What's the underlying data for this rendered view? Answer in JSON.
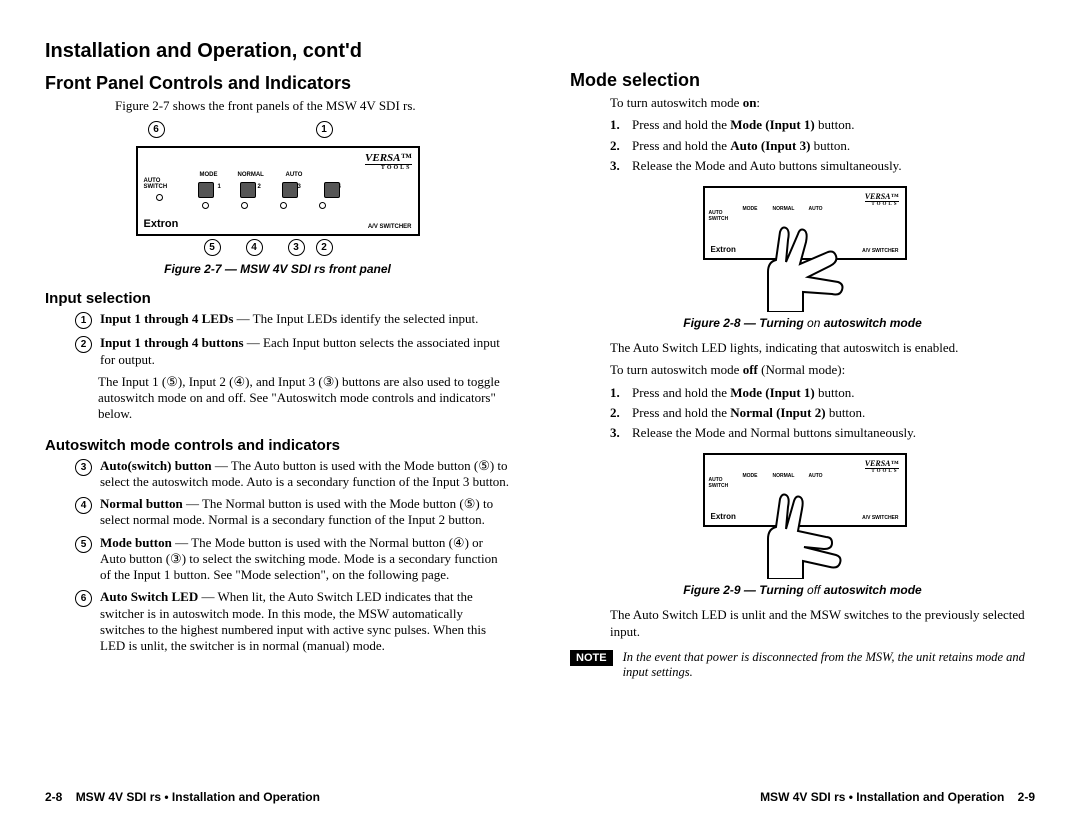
{
  "header": "Installation and Operation, cont'd",
  "left": {
    "h2": "Front Panel Controls and Indicators",
    "intro": "Figure 2-7 shows the front panels of the MSW 4V SDI rs.",
    "fig7_caption": "Figure 2-7 — MSW 4V SDI rs front panel",
    "h3a": "Input selection",
    "item1_lead": "Input 1 through 4 LEDs",
    "item1_body": " — The Input LEDs identify the selected input.",
    "item2_lead": "Input 1 through 4 buttons",
    "item2_body": " — Each Input button selects the associated input for output.",
    "item2_extra": "The Input 1 (⑤), Input 2 (④), and Input 3 (③) buttons are also used to toggle autoswitch mode on and off.  See \"Autoswitch mode controls and indicators\" below.",
    "h3b": "Autoswitch mode controls and indicators",
    "item3_lead": "Auto(switch) button",
    "item3_body": " — The Auto button is used with the Mode button (⑤) to select the autoswitch mode.  Auto is a secondary function of the Input 3 button.",
    "item4_lead": "Normal button",
    "item4_body": " — The Normal button is used with the Mode button (⑤) to select normal mode.  Normal is a secondary function of the Input 2 button.",
    "item5_lead": "Mode button",
    "item5_body": " — The Mode button is used with the Normal button (④) or Auto button (③) to select the switching mode.  Mode is a secondary function of the Input 1 button.  See \"Mode selection\", on the following page.",
    "item6_lead": "Auto Switch LED",
    "item6_body": " — When lit, the Auto Switch LED indicates that the switcher is in autoswitch mode.  In this mode, the MSW automatically switches to the highest numbered input with active sync pulses.  When this LED is unlit, the switcher is in normal (manual) mode."
  },
  "right": {
    "h2": "Mode selection",
    "on_intro_a": "To turn autoswitch mode ",
    "on_intro_b": "on",
    "on_intro_c": ":",
    "on1_a": "Press and hold the ",
    "on1_b": "Mode (Input 1)",
    "on1_c": " button.",
    "on2_a": "Press and hold the ",
    "on2_b": "Auto (Input 3)",
    "on2_c": " button.",
    "on3": "Release the Mode and Auto buttons simultaneously.",
    "fig8_a": "Figure 2-8 — Turning ",
    "fig8_b": "on",
    "fig8_c": " autoswitch mode",
    "after8": "The Auto Switch LED lights, indicating that autoswitch is enabled.",
    "off_intro_a": "To turn autoswitch mode ",
    "off_intro_b": "off",
    "off_intro_c": " (Normal mode):",
    "off1_a": "Press and hold the ",
    "off1_b": "Mode (Input 1)",
    "off1_c": " button.",
    "off2_a": "Press and hold the ",
    "off2_b": "Normal (Input 2)",
    "off2_c": " button.",
    "off3": "Release the Mode and Normal buttons simultaneously.",
    "fig9_a": "Figure 2-9 — Turning ",
    "fig9_b": "off",
    "fig9_c": " autoswitch mode",
    "after9": "The Auto Switch LED is unlit and the MSW switches to the previously selected input.",
    "note_label": "NOTE",
    "note_text": "In the event that power is disconnected from the MSW, the unit retains mode and input settings."
  },
  "panel": {
    "versa": "VERSA",
    "tools": "TOOLS",
    "extron": "Extron",
    "avs": "A/V SWITCHER",
    "auto_switch": "AUTO\nSWITCH",
    "mode": "MODE",
    "normal": "NORMAL",
    "auto": "AUTO",
    "nums": [
      "1",
      "2",
      "3",
      "4"
    ]
  },
  "footer": {
    "left_num": "2-8",
    "title": "MSW 4V SDI rs • Installation and Operation",
    "right_num": "2-9"
  }
}
